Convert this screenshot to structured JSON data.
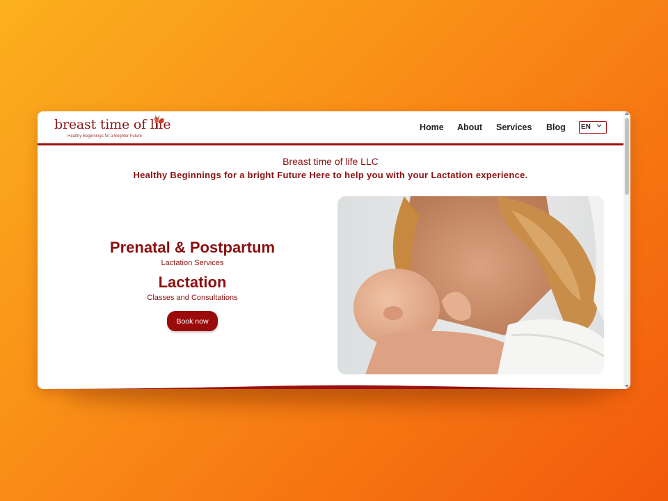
{
  "header": {
    "logo": {
      "name": "breast time of life",
      "tagline": "Healthy Beginnings for a Brighter Future"
    },
    "nav": [
      "Home",
      "About",
      "Services",
      "Blog"
    ],
    "language": "EN"
  },
  "intro": {
    "company": "Breast time of life LLC",
    "tagline": "Healthy Beginnings for a bright Future Here to help you with your Lactation experience."
  },
  "hero": {
    "heading1": "Prenatal & Postpartum",
    "sub1": "Lactation Services",
    "heading2": "Lactation",
    "sub2": "Classes and Consultations",
    "button": "Book now"
  },
  "colors": {
    "background_gradient": [
      "#fbb01e",
      "#f98a16",
      "#f2590c"
    ],
    "accent": "#9b1111",
    "text_accent": "#8b1010",
    "button": "#9b0b0b"
  },
  "icons": [
    "butterfly-icon",
    "chevron-down-icon"
  ]
}
